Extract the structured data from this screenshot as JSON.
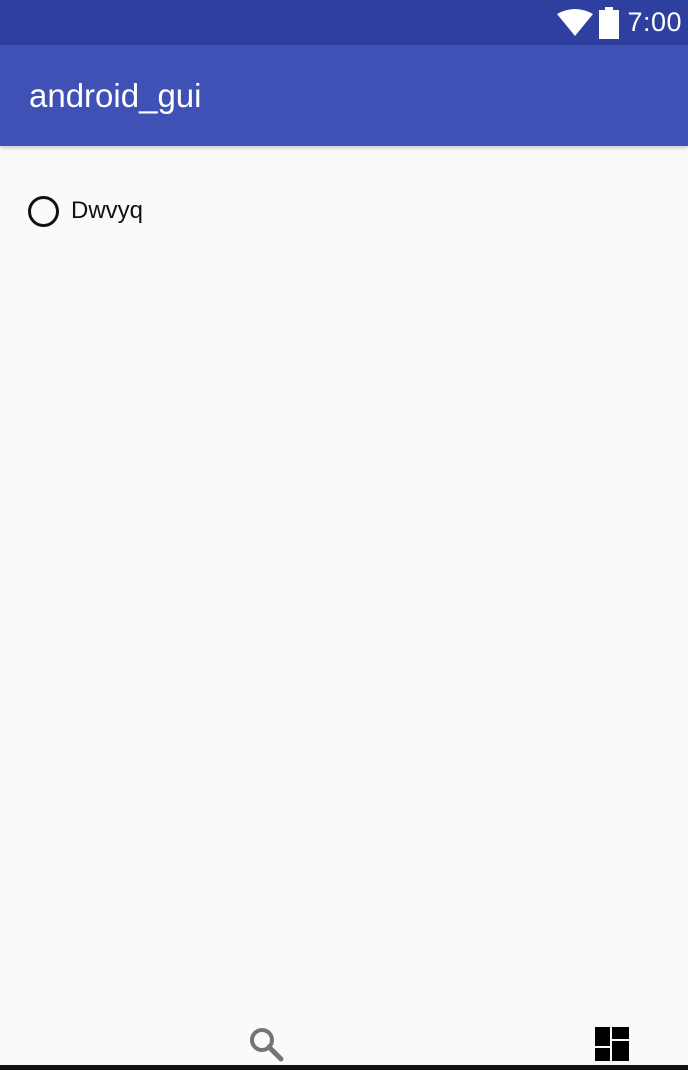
{
  "status_bar": {
    "time": "7:00",
    "icons": [
      "wifi-icon",
      "battery-icon"
    ]
  },
  "app_bar": {
    "title": "android_gui"
  },
  "content": {
    "radio_option": {
      "label": "Dwvyq",
      "checked": false
    }
  },
  "bottom_bar": {
    "icons": [
      "search-icon",
      "dashboard-icon"
    ]
  },
  "colors": {
    "status_bar": "#2e3fa0",
    "app_bar": "#3f51b5",
    "background": "#fafafa",
    "text": "#111111"
  }
}
